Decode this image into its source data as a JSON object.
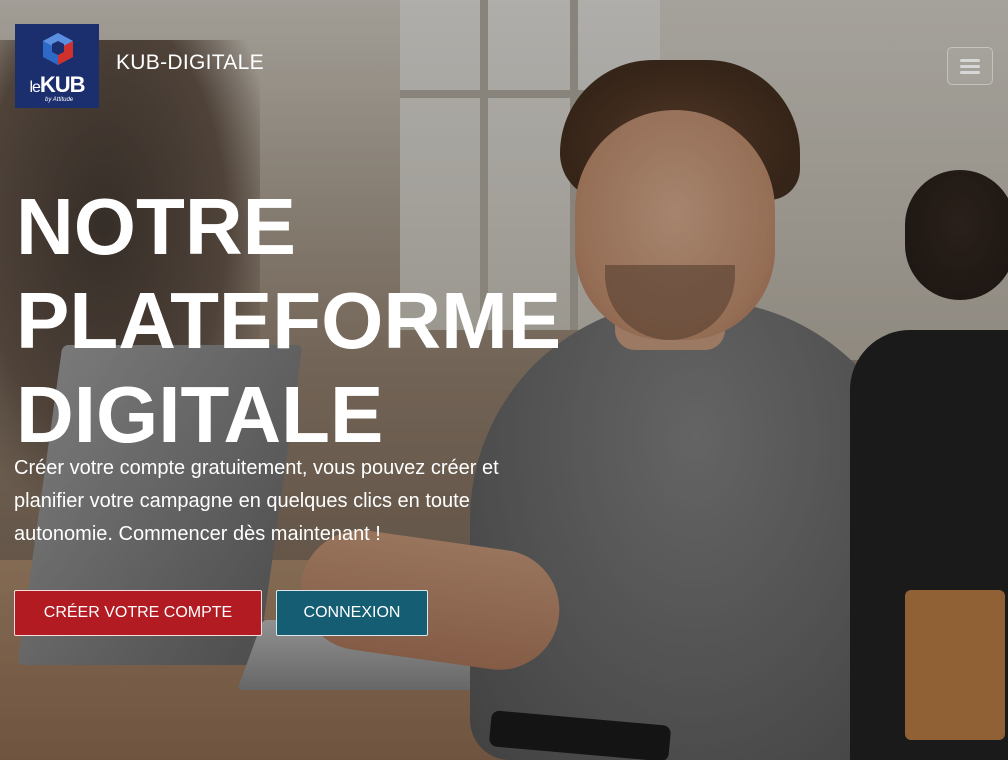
{
  "header": {
    "logo_text_le": "le",
    "logo_text_kub": "KUB",
    "logo_sub": "by Attitude",
    "brand": "KUB-DIGITALE",
    "menu_icon": "hamburger-icon"
  },
  "hero": {
    "title_lines": [
      "NOTRE",
      "PLATEFORME",
      "DIGITALE"
    ],
    "description": "Créer votre compte gratuitement, vous pouvez créer et planifier votre campagne en quelques clics en toute autonomie. Commencer dès maintenant !",
    "create_button": "CRÉER VOTRE COMPTE",
    "login_button": "CONNEXION"
  },
  "colors": {
    "logo_bg": "#1b2f6e",
    "create_button_bg": "#b31b23",
    "login_button_bg": "#145d73"
  }
}
